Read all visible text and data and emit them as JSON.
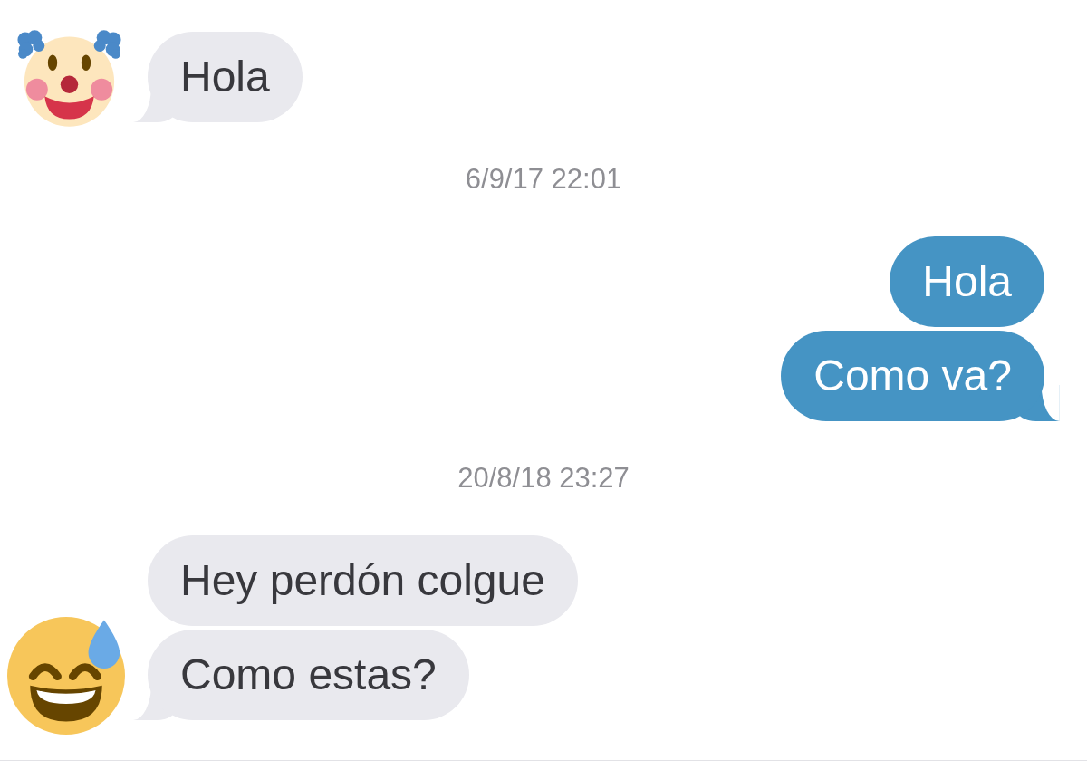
{
  "conversation": [
    {
      "kind": "incoming",
      "messages": [
        "Hola"
      ]
    },
    {
      "kind": "timestamp",
      "text": "6/9/17 22:01"
    },
    {
      "kind": "outgoing",
      "messages": [
        "Hola",
        "Como va?"
      ]
    },
    {
      "kind": "timestamp",
      "text": "20/8/18 23:27"
    },
    {
      "kind": "incoming",
      "messages": [
        "Hey perdón colgue",
        "Como estas?"
      ]
    }
  ]
}
